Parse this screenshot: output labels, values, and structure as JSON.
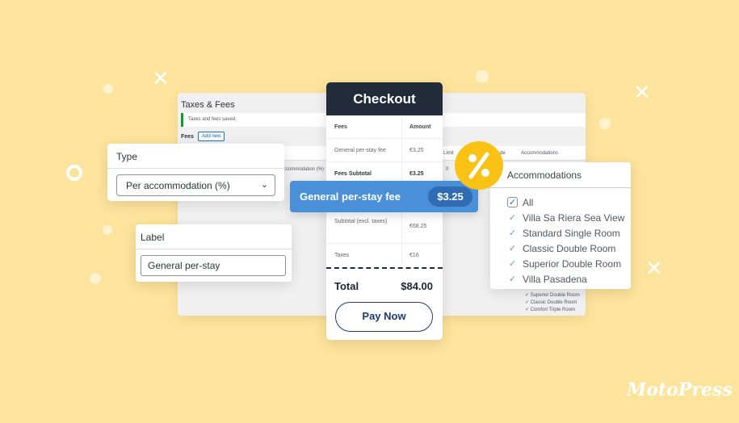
{
  "admin": {
    "title": "Taxes & Fees",
    "notice": "Taxes and fees saved.",
    "fees_label": "Fees",
    "add_new": "Add new",
    "columns": [
      "ccommodation (%)",
      "Limit",
      "de",
      "Accommodations"
    ],
    "row_value": "0",
    "list": [
      "Superior Double Room",
      "Classic Double Room",
      "Comfort Triple Room"
    ]
  },
  "type_card": {
    "label": "Type",
    "value": "Per accommodation (%)"
  },
  "label_card": {
    "label": "Label",
    "value": "General per-stay"
  },
  "checkout": {
    "title": "Checkout",
    "header": {
      "fees": "Fees",
      "amount": "Amount"
    },
    "rows": [
      {
        "label": "General per-stay fee",
        "value": "€3.25"
      },
      {
        "label": "Fees Subtotal",
        "value": "€3.25"
      },
      {
        "label": "Subtotal (excl. taxes)",
        "value": "€68.25"
      },
      {
        "label": "Taxes",
        "value": "€16"
      }
    ],
    "total_label": "Total",
    "total_value": "$84.00",
    "pay_button": "Pay Now"
  },
  "fee_pill": {
    "label": "General per-stay fee",
    "value": "$3.25"
  },
  "percent_badge": {
    "icon": "percent-icon",
    "color": "#f9c215"
  },
  "accommodations": {
    "title": "Accommodations",
    "items": [
      {
        "label": "All",
        "checked": true
      },
      {
        "label": "Villa Sa Riera Sea View",
        "checked": true
      },
      {
        "label": "Standard Single Room",
        "checked": true
      },
      {
        "label": "Classic Double Room",
        "checked": true
      },
      {
        "label": "Superior Double Room",
        "checked": true
      },
      {
        "label": "Villa Pasadena",
        "checked": true
      }
    ]
  },
  "brand": {
    "logo": "MotoPress"
  },
  "colors": {
    "background": "#fde49c",
    "dark": "#222b3a",
    "blue": "#4a90d9",
    "navy": "#1d3a72"
  }
}
